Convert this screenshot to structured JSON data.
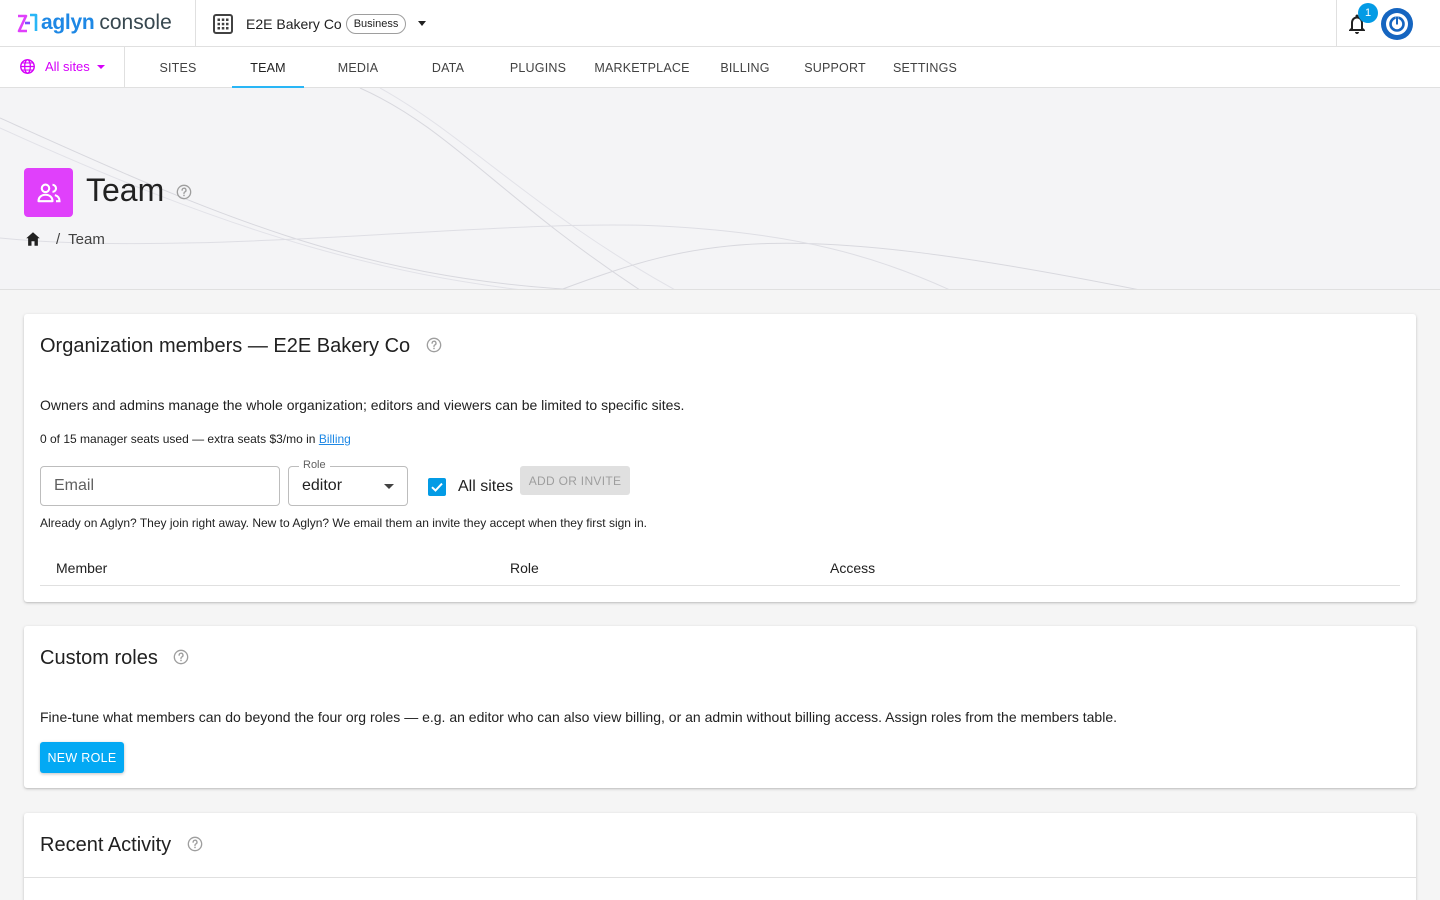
{
  "header": {
    "logo_brand": "aglyn",
    "logo_rest": "console",
    "org_name": "E2E Bakery Co",
    "plan_badge": "Business",
    "notification_count": "1"
  },
  "nav": {
    "site_selector": "All sites",
    "tabs": [
      "SITES",
      "TEAM",
      "MEDIA",
      "DATA",
      "PLUGINS",
      "MARKETPLACE",
      "BILLING",
      "SUPPORT",
      "SETTINGS"
    ],
    "active_tab": "TEAM"
  },
  "hero": {
    "title": "Team",
    "breadcrumb_current": "Team"
  },
  "members": {
    "title": "Organization members — E2E Bakery Co",
    "description": "Owners and admins manage the whole organization; editors and viewers can be limited to specific sites.",
    "seats_text": "0 of 15 manager seats used — extra seats $3/mo in ",
    "seats_link": "Billing",
    "email_placeholder": "Email",
    "role_label": "Role",
    "role_value": "editor",
    "all_sites_label": "All sites",
    "all_sites_checked": true,
    "add_button": "ADD OR INVITE",
    "helper_text": "Already on Aglyn? They join right away. New to Aglyn? We email them an invite they accept when they first sign in.",
    "columns": [
      "Member",
      "Role",
      "Access"
    ]
  },
  "custom_roles": {
    "title": "Custom roles",
    "description": "Fine-tune what members can do beyond the four org roles — e.g. an editor who can also view billing, or an admin without billing access. Assign roles from the members table.",
    "new_button": "NEW ROLE"
  },
  "activity": {
    "title": "Recent Activity"
  },
  "colors": {
    "accent": "#03a9f4",
    "tab_indicator": "#29b6f6",
    "site_selector": "#d500f9",
    "team_icon_bg": "#e040fb",
    "avatar_bg": "#1565c0",
    "link": "#1e88e5"
  }
}
